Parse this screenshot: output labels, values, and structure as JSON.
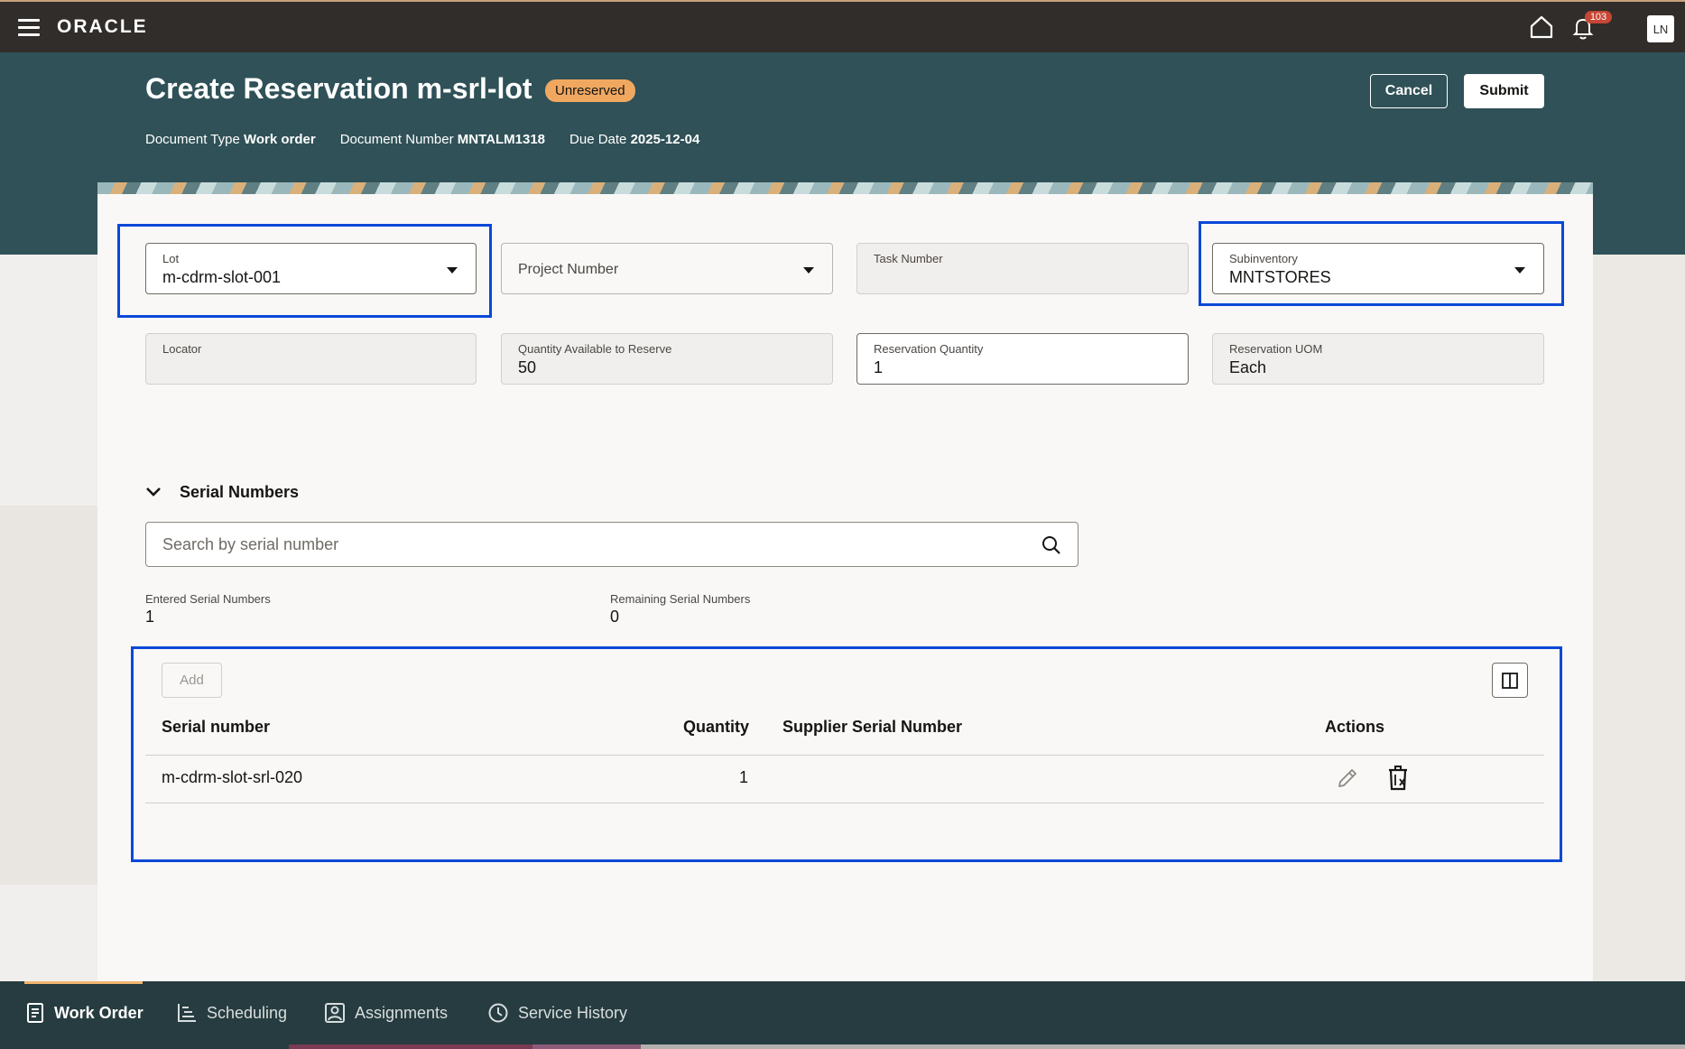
{
  "topbar": {
    "brand": "ORACLE",
    "notification_count": "103",
    "avatar_initials": "LN"
  },
  "header": {
    "title": "Create Reservation m-srl-lot",
    "status": "Unreserved",
    "doc_type_label": "Document Type",
    "doc_type_value": "Work order",
    "doc_number_label": "Document Number",
    "doc_number_value": "MNTALM1318",
    "due_date_label": "Due Date",
    "due_date_value": "2025-12-04",
    "cancel_label": "Cancel",
    "submit_label": "Submit"
  },
  "form": {
    "lot": {
      "label": "Lot",
      "value": "m-cdrm-slot-001"
    },
    "project_number": {
      "placeholder": "Project Number"
    },
    "task_number": {
      "label": "Task Number"
    },
    "subinventory": {
      "label": "Subinventory",
      "value": "MNTSTORES"
    },
    "locator": {
      "label": "Locator"
    },
    "qty_available": {
      "label": "Quantity Available to Reserve",
      "value": "50"
    },
    "reservation_qty": {
      "label": "Reservation Quantity",
      "value": "1"
    },
    "reservation_uom": {
      "label": "Reservation UOM",
      "value": "Each"
    }
  },
  "serials": {
    "title": "Serial Numbers",
    "search_placeholder": "Search by serial number",
    "entered_label": "Entered Serial Numbers",
    "entered_value": "1",
    "remaining_label": "Remaining Serial Numbers",
    "remaining_value": "0",
    "add_label": "Add",
    "columns": [
      "Serial number",
      "Quantity",
      "Supplier Serial Number",
      "Actions"
    ],
    "rows": [
      {
        "serial": "m-cdrm-slot-srl-020",
        "quantity": "1",
        "supplier_serial": ""
      }
    ]
  },
  "bottom_tabs": [
    {
      "label": "Work Order",
      "icon": "document-icon",
      "active": true
    },
    {
      "label": "Scheduling",
      "icon": "gantt-icon",
      "active": false
    },
    {
      "label": "Assignments",
      "icon": "person-badge-icon",
      "active": false
    },
    {
      "label": "Service History",
      "icon": "clock-icon",
      "active": false
    }
  ],
  "colors": {
    "header_bg": "#2f5157",
    "topbar_bg": "#312d2a",
    "status_badge": "#f0a860",
    "highlight": "#0a48d8",
    "bottombar_bg": "#263c40"
  }
}
